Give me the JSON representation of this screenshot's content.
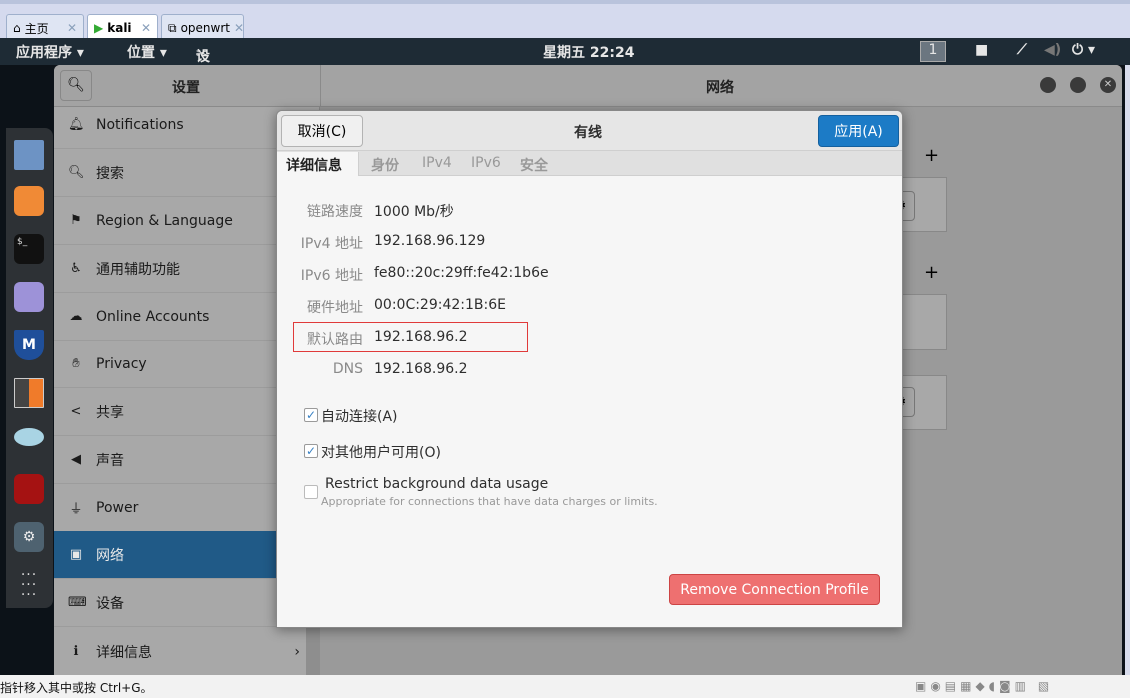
{
  "vm_tabs": [
    {
      "label": "主页",
      "icon": "home-icon"
    },
    {
      "label": "kali",
      "icon": "vm-running-icon"
    },
    {
      "label": "openwrt",
      "icon": "vm-icon"
    }
  ],
  "topbar": {
    "apps": "应用程序 ▾",
    "places": "位置 ▾",
    "settings": "设置 ▾",
    "clock": "星期五 22:24",
    "workspace": "1"
  },
  "settings": {
    "sidebar_title": "设置",
    "panel_title": "网络",
    "items": [
      {
        "label": "Notifications",
        "icon": "bell-icon"
      },
      {
        "label": "搜索",
        "icon": "search-icon"
      },
      {
        "label": "Region & Language",
        "icon": "flag-icon"
      },
      {
        "label": "通用辅助功能",
        "icon": "accessibility-icon"
      },
      {
        "label": "Online Accounts",
        "icon": "cloud-icon"
      },
      {
        "label": "Privacy",
        "icon": "hand-icon"
      },
      {
        "label": "共享",
        "icon": "share-icon"
      },
      {
        "label": "声音",
        "icon": "speaker-icon"
      },
      {
        "label": "Power",
        "icon": "power-plug-icon"
      },
      {
        "label": "网络",
        "icon": "network-icon",
        "selected": true
      },
      {
        "label": "设备",
        "icon": "devices-icon"
      },
      {
        "label": "详细信息",
        "icon": "info-icon"
      }
    ]
  },
  "dialog": {
    "title": "有线",
    "cancel": "取消(C)",
    "apply": "应用(A)",
    "accent": "#1c7bc6",
    "tabs": [
      "详细信息",
      "身份",
      "IPv4",
      "IPv6",
      "安全"
    ],
    "details": [
      {
        "k": "链路速度",
        "v": "1000 Mb/秒"
      },
      {
        "k": "IPv4 地址",
        "v": "192.168.96.129"
      },
      {
        "k": "IPv6 地址",
        "v": "fe80::20c:29ff:fe42:1b6e"
      },
      {
        "k": "硬件地址",
        "v": "00:0C:29:42:1B:6E"
      },
      {
        "k": "默认路由",
        "v": "192.168.96.2",
        "highlighted": true
      },
      {
        "k": "DNS",
        "v": "192.168.96.2"
      }
    ],
    "auto_connect": {
      "label": "自动连接(A)",
      "checked": true
    },
    "all_users": {
      "label": "对其他用户可用(O)",
      "checked": true
    },
    "restrict": {
      "label": "Restrict background data usage",
      "desc": "Appropriate for connections that have data charges or limits.",
      "checked": false
    },
    "remove": "Remove Connection Profile"
  },
  "statusbar": {
    "text": "指针移入其中或按 Ctrl+G。"
  }
}
